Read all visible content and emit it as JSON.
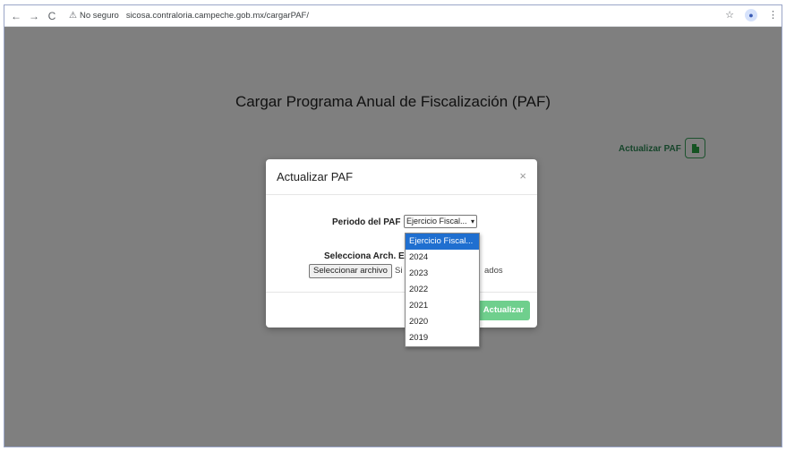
{
  "browser": {
    "back": "←",
    "forward": "→",
    "reload": "C",
    "security_label": "No seguro",
    "url": "sicosa.contraloria.campeche.gob.mx/cargarPAF/"
  },
  "page": {
    "title": "Cargar Programa Anual de Fiscalización (PAF)",
    "update_link": "Actualizar PAF"
  },
  "modal": {
    "title": "Actualizar PAF",
    "close": "×",
    "periodo_label": "Periodo del PAF",
    "selected_option": "Ejercicio Fiscal...",
    "archivo_label_visible": "Selecciona Arch. Ex",
    "archivo_label_tail": ":",
    "file_button": "Seleccionar archivo",
    "file_status_start": "Si",
    "file_status_end": "ados",
    "submit_label": "Actualizar"
  },
  "dropdown": {
    "options": [
      "Ejercicio Fiscal...",
      "2024",
      "2023",
      "2022",
      "2021",
      "2020",
      "2019"
    ]
  },
  "colors": {
    "accent_green": "#2e8b57",
    "selected_blue": "#1f6fd0"
  }
}
